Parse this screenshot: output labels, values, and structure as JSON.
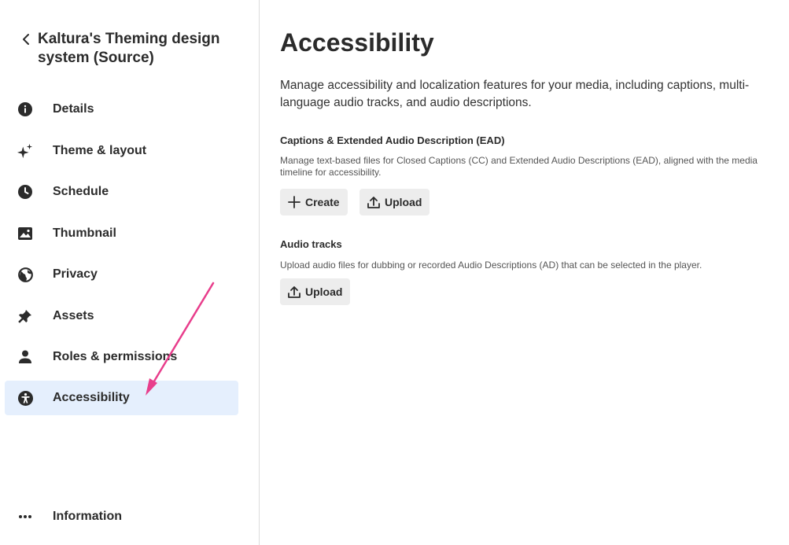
{
  "sidebar": {
    "back_title": "Kaltura's Theming design system (Source)",
    "items": [
      {
        "label": "Details",
        "icon": "info-icon"
      },
      {
        "label": "Theme & layout",
        "icon": "sparkle-icon"
      },
      {
        "label": "Schedule",
        "icon": "clock-icon"
      },
      {
        "label": "Thumbnail",
        "icon": "image-icon"
      },
      {
        "label": "Privacy",
        "icon": "globe-icon"
      },
      {
        "label": "Assets",
        "icon": "pin-icon"
      },
      {
        "label": "Roles & permissions",
        "icon": "person-icon"
      },
      {
        "label": "Accessibility",
        "icon": "accessibility-icon",
        "active": true
      }
    ],
    "bottom": {
      "label": "Information",
      "icon": "more-icon"
    }
  },
  "main": {
    "title": "Accessibility",
    "description": "Manage accessibility and localization features for your media, including captions, multi-language audio tracks, and audio descriptions.",
    "captions": {
      "title": "Captions & Extended Audio Description (EAD)",
      "description": "Manage text-based files for Closed Captions (CC) and Extended Audio Descriptions (EAD), aligned with the media timeline for accessibility.",
      "create_label": "Create",
      "upload_label": "Upload"
    },
    "audio": {
      "title": "Audio tracks",
      "description": "Upload audio files for dubbing or recorded Audio Descriptions (AD) that can be selected in the player.",
      "upload_label": "Upload"
    }
  },
  "colors": {
    "active_bg": "#e5effd",
    "annotation_arrow": "#e83e8c",
    "button_bg": "#ededed"
  }
}
